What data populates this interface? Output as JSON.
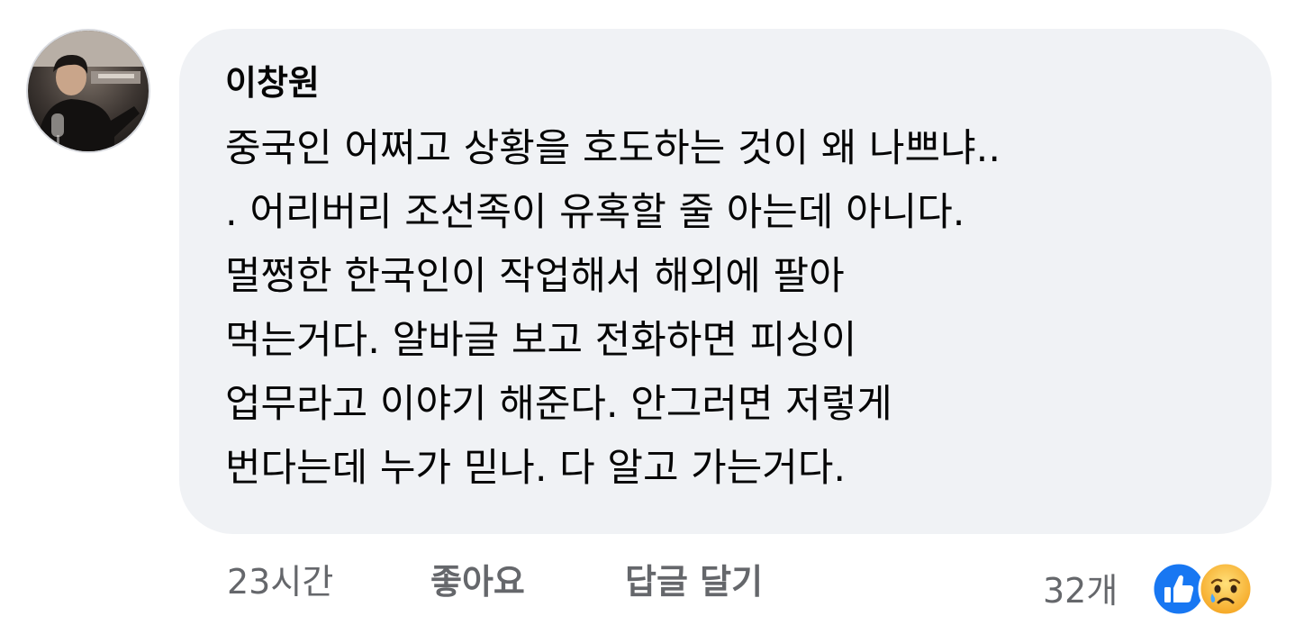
{
  "comment": {
    "author": "이창원",
    "lines": [
      "중국인 어쩌고 상황을 호도하는 것이 왜 나쁘냐..",
      ". 어리버리 조선족이 유혹할 줄 아는데 아니다.",
      "멀쩡한 한국인이 작업해서 해외에 팔아",
      "먹는거다. 알바글 보고 전화하면 피싱이",
      "업무라고 이야기 해준다. 안그러면 저렇게",
      "번다는데 누가 믿나. 다 알고 가는거다."
    ],
    "avatar_icon": "profile-photo"
  },
  "meta": {
    "time": "23시간",
    "like_label": "좋아요",
    "reply_label": "답글 달기"
  },
  "reactions": {
    "count": "32개",
    "icons": [
      "like-icon",
      "sad-icon"
    ]
  },
  "colors": {
    "bubble": "#f0f2f5",
    "text": "#050505",
    "meta": "#65676b",
    "like_blue": "#1877f2",
    "sad_yellow": "#f7b928"
  }
}
